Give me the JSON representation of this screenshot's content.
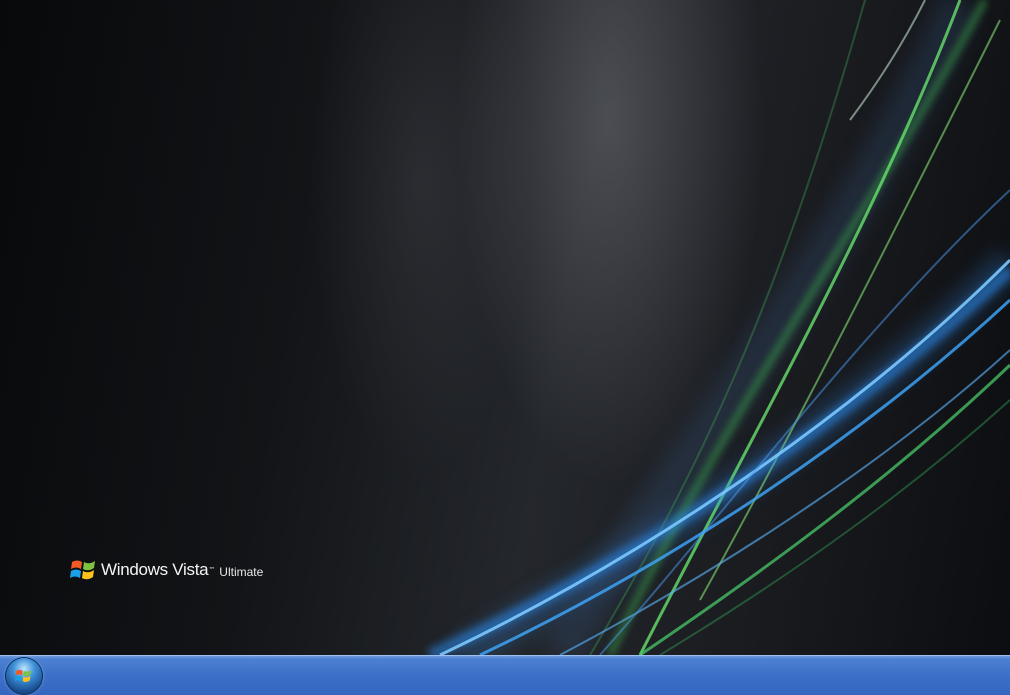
{
  "desktop": {
    "brand": {
      "name": "Windows Vista",
      "trademark": "™",
      "edition": "Ultimate"
    }
  },
  "taskbar": {
    "start_button_icon": "windows-flag-icon"
  },
  "colors": {
    "taskbar": "#3c70c8",
    "streak_blue": "#3fa9ff",
    "streak_green": "#4fd85a",
    "background": "#0d0e11"
  }
}
